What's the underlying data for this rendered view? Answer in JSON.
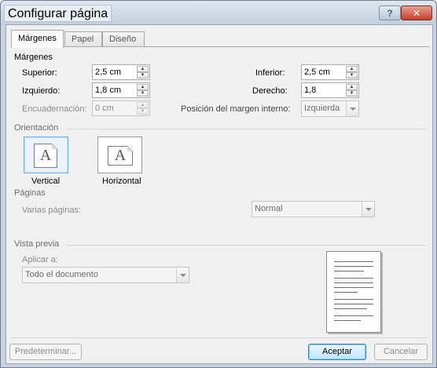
{
  "window": {
    "title": "Configurar página",
    "help_label": "?",
    "close_label": "✕"
  },
  "tabs": [
    {
      "label": "Márgenes",
      "active": true
    },
    {
      "label": "Papel",
      "active": false
    },
    {
      "label": "Diseño",
      "active": false
    }
  ],
  "margins": {
    "heading": "Márgenes",
    "top_label": "Superior:",
    "top_value": "2,5 cm",
    "bottom_label": "Inferior:",
    "bottom_value": "2,5 cm",
    "left_label": "Izquierdo:",
    "left_value": "1,8 cm",
    "right_label": "Derecho:",
    "right_value": "1,8",
    "gutter_label": "Encuadernación:",
    "gutter_value": "0 cm",
    "gutter_pos_label": "Posición del margen interno:",
    "gutter_pos_value": "Izquierda"
  },
  "orientation": {
    "heading": "Orientación",
    "portrait_label": "Vertical",
    "landscape_label": "Horizontal",
    "selected": "Vertical",
    "icon_glyph": "A"
  },
  "pages": {
    "heading": "Páginas",
    "multiple_label": "Varias páginas:",
    "multiple_value": "Normal"
  },
  "preview": {
    "heading": "Vista previa",
    "apply_label": "Aplicar a:",
    "apply_value": "Todo el documento"
  },
  "buttons": {
    "default_label": "Predeterminar...",
    "ok_label": "Aceptar",
    "cancel_label": "Cancelar"
  },
  "icons": {
    "spin_up": "▲",
    "spin_down": "▼"
  }
}
